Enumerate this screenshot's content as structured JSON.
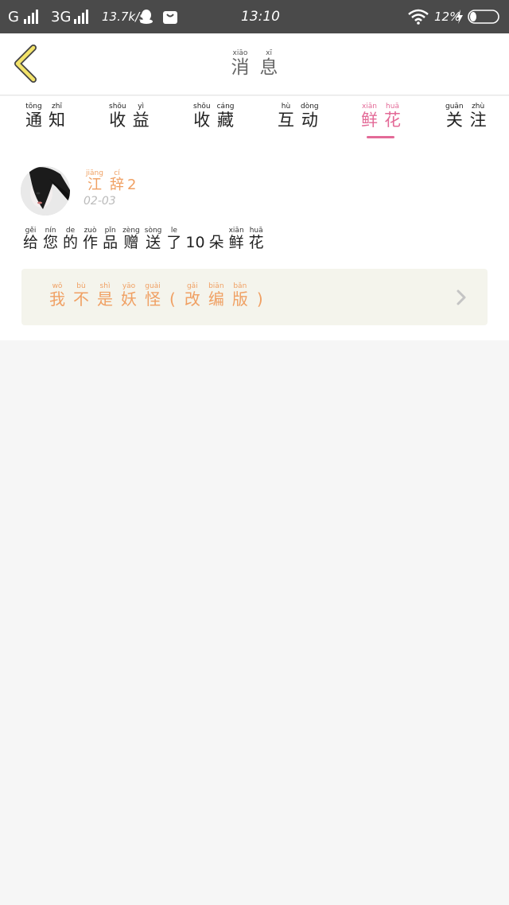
{
  "status_bar": {
    "carrier": "G",
    "network": "3G",
    "speed": "13.7k/s",
    "time": "13:10",
    "battery": "12%"
  },
  "header": {
    "title": [
      {
        "hz": "消",
        "py": "xiāo"
      },
      {
        "hz": "息",
        "py": "xī"
      }
    ]
  },
  "tabs": [
    {
      "chars": [
        {
          "hz": "通",
          "py": "tōng"
        },
        {
          "hz": "知",
          "py": "zhī"
        }
      ]
    },
    {
      "chars": [
        {
          "hz": "收",
          "py": "shōu"
        },
        {
          "hz": "益",
          "py": "yì"
        }
      ]
    },
    {
      "chars": [
        {
          "hz": "收",
          "py": "shōu"
        },
        {
          "hz": "藏",
          "py": "cáng"
        }
      ]
    },
    {
      "chars": [
        {
          "hz": "互",
          "py": "hù"
        },
        {
          "hz": "动",
          "py": "dòng"
        }
      ]
    },
    {
      "chars": [
        {
          "hz": "鲜",
          "py": "xiān"
        },
        {
          "hz": "花",
          "py": "huā"
        }
      ],
      "active": true
    },
    {
      "chars": [
        {
          "hz": "关",
          "py": "guān"
        },
        {
          "hz": "注",
          "py": "zhù"
        }
      ]
    }
  ],
  "notification": {
    "username": [
      {
        "hz": "江",
        "py": "jiāng"
      },
      {
        "hz": "辞",
        "py": "cí"
      }
    ],
    "username_suffix": "2",
    "date": "02-03",
    "message": [
      {
        "hz": "给",
        "py": "gěi"
      },
      {
        "hz": "您",
        "py": "nín"
      },
      {
        "hz": "的",
        "py": "de"
      },
      {
        "hz": "作",
        "py": "zuò"
      },
      {
        "hz": "品",
        "py": "pǐn"
      },
      {
        "hz": "赠",
        "py": "zèng"
      },
      {
        "hz": "送",
        "py": "sòng"
      },
      {
        "hz": "了",
        "py": "le"
      }
    ],
    "message_count": "10",
    "message_tail": [
      {
        "hz": "朵",
        "py": ""
      },
      {
        "hz": "鲜",
        "py": "xiān"
      },
      {
        "hz": "花",
        "py": "huā"
      }
    ],
    "work_title": [
      {
        "hz": "我",
        "py": "wǒ"
      },
      {
        "hz": "不",
        "py": "bù"
      },
      {
        "hz": "是",
        "py": "shì"
      },
      {
        "hz": "妖",
        "py": "yāo"
      },
      {
        "hz": "怪",
        "py": "guài"
      }
    ],
    "work_open_paren": "(",
    "work_title_edition": [
      {
        "hz": "改",
        "py": "gǎi"
      },
      {
        "hz": "编",
        "py": "biān"
      },
      {
        "hz": "版",
        "py": "bǎn"
      }
    ],
    "work_close_paren": ")"
  },
  "colors": {
    "accent": "#e36a97",
    "orange": "#f0a063",
    "statusbar": "#4a4a4a"
  }
}
